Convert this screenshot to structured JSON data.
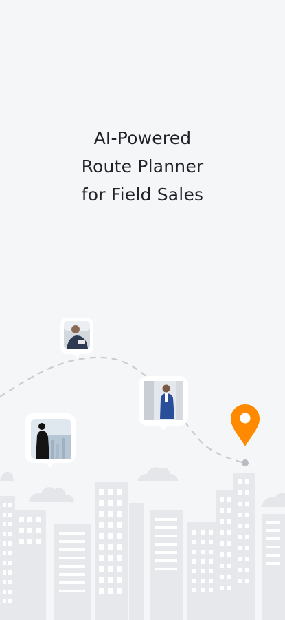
{
  "headline": {
    "line1": "AI-Powered",
    "line2": "Route Planner",
    "line3": "for Field Sales"
  },
  "colors": {
    "background": "#f5f6f8",
    "text": "#1f2228",
    "pin": "#ff8a00",
    "buildings": "#e1e3e6",
    "windows": "#ffffff",
    "route": "#c9ccd1"
  },
  "icons": {
    "pin": "location-pin-icon"
  }
}
